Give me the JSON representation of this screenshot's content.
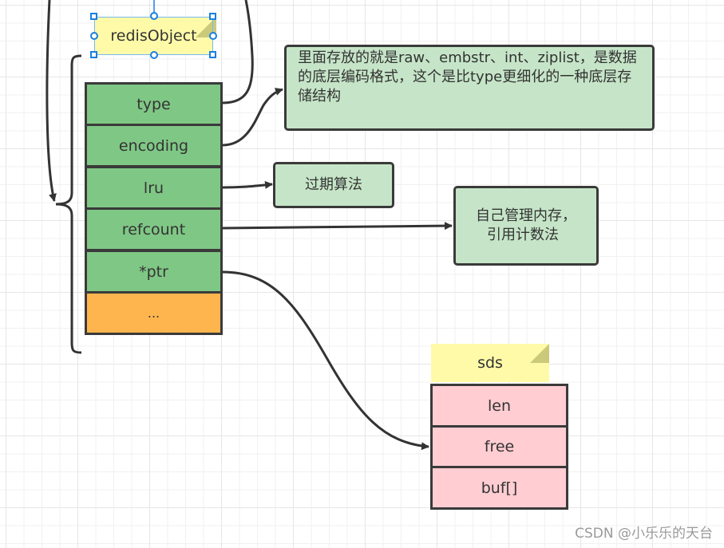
{
  "diagram": {
    "title_note": {
      "label": "redisObject",
      "selected": true
    },
    "redis_object_fields": [
      {
        "label": "type",
        "color": "#7fc785"
      },
      {
        "label": "encoding",
        "color": "#7fc785"
      },
      {
        "label": "lru",
        "color": "#7fc785"
      },
      {
        "label": "refcount",
        "color": "#7fc785"
      },
      {
        "label": "*ptr",
        "color": "#7fc785"
      },
      {
        "label": "...",
        "color": "#ffb54e"
      }
    ],
    "annotations": {
      "encoding_note": "里面存放的就是raw、embstr、int、ziplist，是数据的底层编码格式，这个是比type更细化的一种底层存储结构",
      "lru_note": "过期算法",
      "refcount_note_line1": "自己管理内存，",
      "refcount_note_line2": "引用计数法"
    },
    "sds_note": {
      "label": "sds"
    },
    "sds_fields": [
      {
        "label": "len",
        "color": "#ffcdd2"
      },
      {
        "label": "free",
        "color": "#ffcdd2"
      },
      {
        "label": "buf[]",
        "color": "#ffcdd2"
      }
    ],
    "colors": {
      "selection": "#1a7fe0",
      "note_fill": "#c6e5c8",
      "sticky_fill": "#fffaa8",
      "stroke": "#3a3a3a"
    }
  },
  "watermark": "CSDN @小乐乐的天台"
}
